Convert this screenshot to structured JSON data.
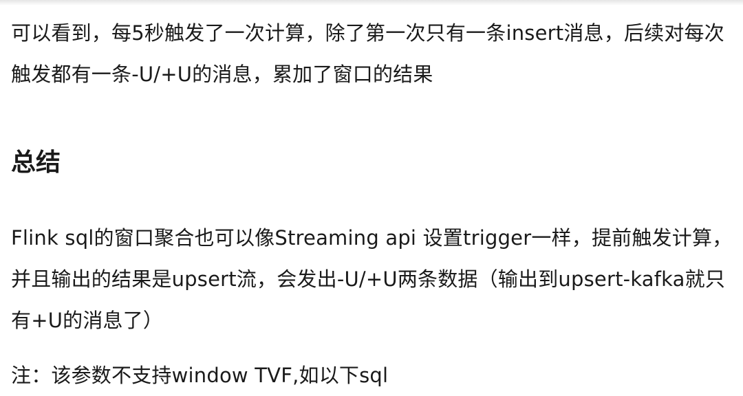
{
  "article": {
    "paragraph_1": "可以看到，每5秒触发了一次计算，除了第一次只有一条insert消息，后续对每次触发都有一条-U/+U的消息，累加了窗口的结果",
    "section_heading": "总结",
    "paragraph_2": "Flink sql的窗口聚合也可以像Streaming api 设置trigger一样，提前触发计算，并且输出的结果是upsert流，会发出-U/+U两条数据（输出到upsert-kafka就只有+U的消息了）",
    "paragraph_3": "注：该参数不支持window TVF,如以下sql"
  }
}
